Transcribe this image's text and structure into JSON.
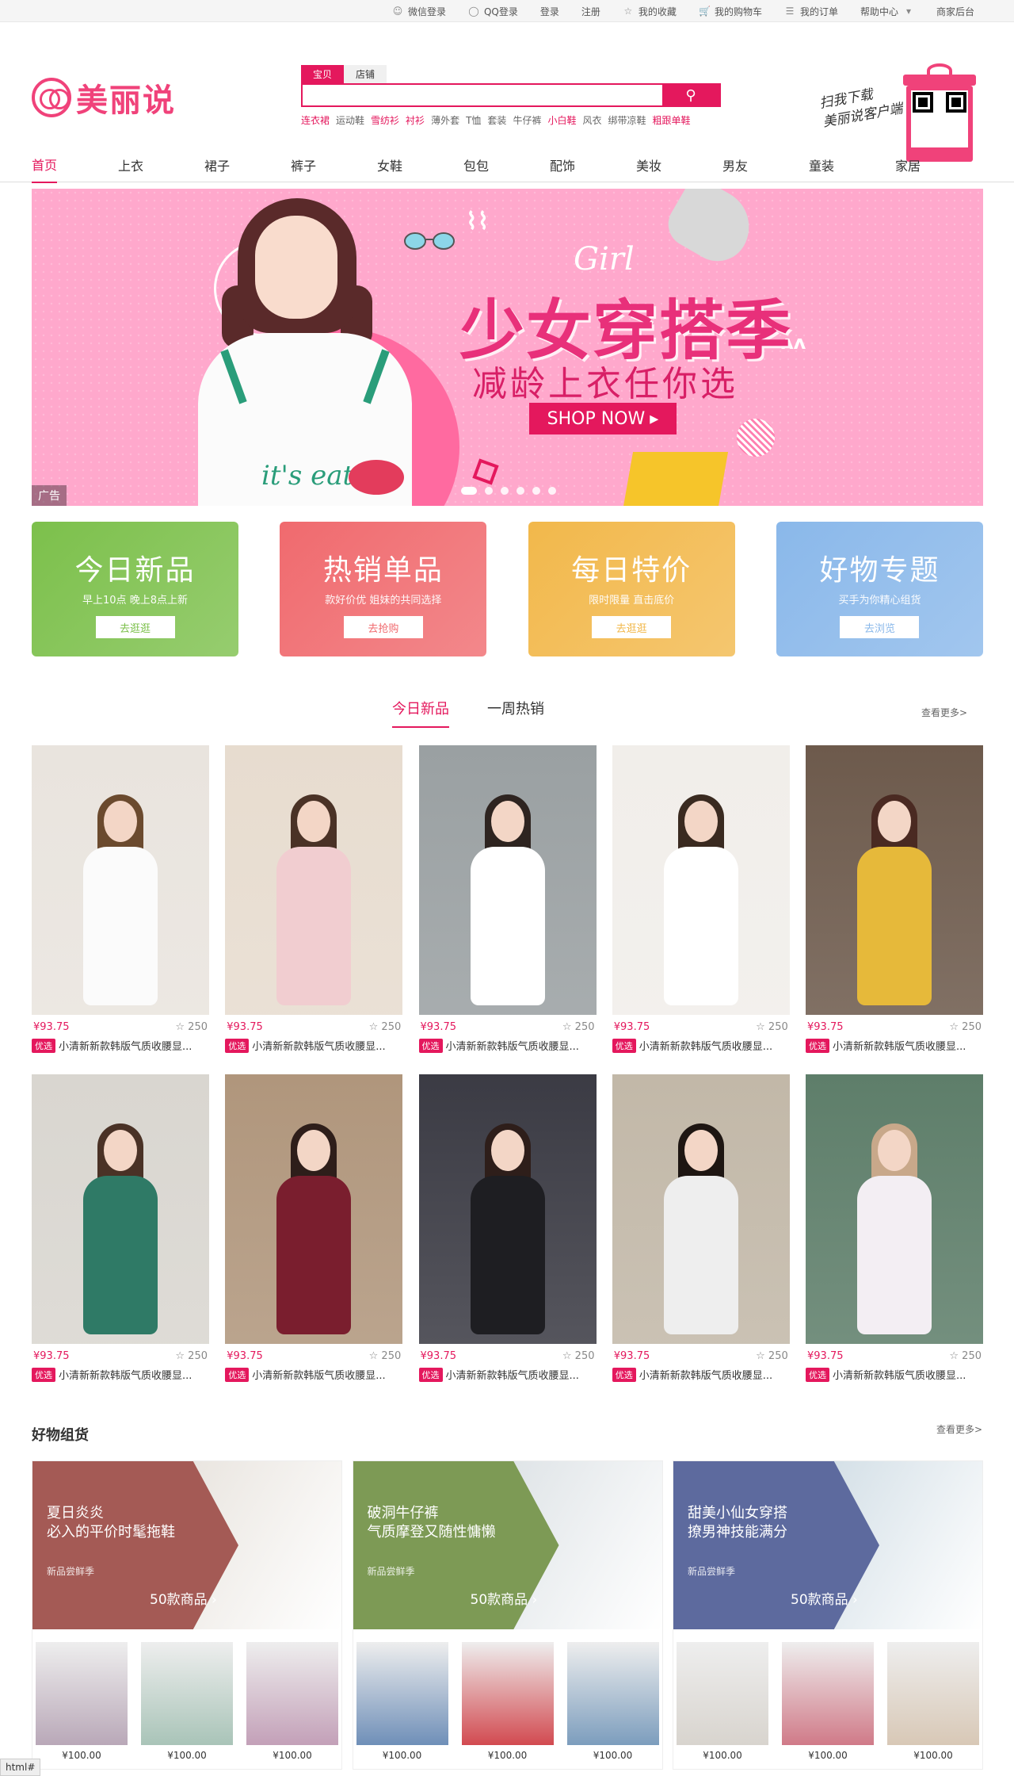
{
  "topbar": {
    "items": [
      "微信登录",
      "QQ登录",
      "登录",
      "注册",
      "我的收藏",
      "我的购物车",
      "我的订单",
      "帮助中心",
      "商家后台"
    ]
  },
  "logo": {
    "text": "美丽说"
  },
  "search": {
    "tabs": [
      "宝贝",
      "店铺"
    ],
    "active_tab": "宝贝",
    "value": "",
    "hot_words": [
      "连衣裙",
      "运动鞋",
      "雪纺衫",
      "衬衫",
      "薄外套",
      "T恤",
      "套装",
      "牛仔裤",
      "小白鞋",
      "风衣",
      "绑带凉鞋",
      "粗跟单鞋"
    ],
    "hot_red": [
      "连衣裙",
      "雪纺衫",
      "衬衫",
      "小白鞋",
      "粗跟单鞋"
    ]
  },
  "download": {
    "line1": "扫我下载",
    "line2": "美丽说客户端"
  },
  "nav": {
    "items": [
      "首页",
      "上衣",
      "裙子",
      "裤子",
      "女鞋",
      "包包",
      "配饰",
      "美妆",
      "男友",
      "童装",
      "家居"
    ],
    "active": "首页"
  },
  "banner": {
    "girl": "Girl",
    "title": "少女穿搭季",
    "subtitle": "减龄上衣任你选",
    "button": "SHOP NOW",
    "model_text": "it's eat",
    "ad_label": "广告",
    "slides": 6,
    "active_slide": 0
  },
  "promos": [
    {
      "title": "今日新品",
      "desc": "早上10点 晚上8点上新",
      "button": "去逛逛",
      "color": "#7cc04b"
    },
    {
      "title": "热销单品",
      "desc": "款好价优 姐妹的共同选择",
      "button": "去抢购",
      "color": "#f06a6e"
    },
    {
      "title": "每日特价",
      "desc": "限时限量 直击底价",
      "button": "去逛逛",
      "color": "#f2b84b"
    },
    {
      "title": "好物专题",
      "desc": "买手为你精心组货",
      "button": "去浏览",
      "color": "#8ab8ea"
    }
  ],
  "section_tabs": {
    "items": [
      "今日新品",
      "一周热销"
    ],
    "active": "今日新品",
    "more": "查看更多>"
  },
  "products": {
    "price": "¥93.75",
    "favorites": "250",
    "tag": "优选",
    "name": "小清新新款韩版气质收腰显...",
    "rows": [
      [
        {
          "bg": "#e9e4de",
          "dress": "#fbfbfb",
          "hair": "#6b4a2e"
        },
        {
          "bg": "#e7dccf",
          "dress": "#f1cdd0",
          "hair": "#4a3226"
        },
        {
          "bg": "#9aa0a2",
          "dress": "#ffffff",
          "hair": "#2e2420"
        },
        {
          "bg": "#f1eeea",
          "dress": "#ffffff",
          "hair": "#3a2a20"
        },
        {
          "bg": "#6d5a4c",
          "dress": "#e6b93a",
          "hair": "#4a2a22"
        }
      ],
      [
        {
          "bg": "#d9d6d0",
          "dress": "#2f7a66",
          "hair": "#4a3226"
        },
        {
          "bg": "#b0967c",
          "dress": "#7a1e2e",
          "hair": "#2e1e1a"
        },
        {
          "bg": "#3b3b44",
          "dress": "#1e1e22",
          "hair": "#2e1e1a"
        },
        {
          "bg": "#c2b8a8",
          "dress": "#eeeeee",
          "hair": "#1e1612"
        },
        {
          "bg": "#5e7e6a",
          "dress": "#f3eef3",
          "hair": "#c8a88a"
        }
      ]
    ]
  },
  "bundles_section": {
    "title": "好物组货",
    "more": "查看更多>"
  },
  "bundles": [
    {
      "line1": "夏日炎炎",
      "line2": "必入的平价时髦拖鞋",
      "label": "新品尝鲜季",
      "count": "50款商品",
      "color": "#a45a55",
      "photo": "#dcd5cc",
      "items": [
        {
          "price": "¥100.00",
          "c": "#b9a8b8"
        },
        {
          "price": "¥100.00",
          "c": "#a9c4b8"
        },
        {
          "price": "¥100.00",
          "c": "#c3a0b8"
        }
      ]
    },
    {
      "line1": "破洞牛仔裤",
      "line2": "气质摩登又随性慵懒",
      "label": "新品尝鲜季",
      "count": "50款商品",
      "color": "#7d9a55",
      "photo": "#cbd3d8",
      "items": [
        {
          "price": "¥100.00",
          "c": "#6f8fb8"
        },
        {
          "price": "¥100.00",
          "c": "#d24a50"
        },
        {
          "price": "¥100.00",
          "c": "#7c9dbd"
        }
      ]
    },
    {
      "line1": "甜美小仙女穿搭",
      "line2": "撩男神技能满分",
      "label": "新品尝鲜季",
      "count": "50款商品",
      "color": "#5d6a9e",
      "photo": "#b9ccd8",
      "items": [
        {
          "price": "¥100.00",
          "c": "#d8d4ce"
        },
        {
          "price": "¥100.00",
          "c": "#d07a88"
        },
        {
          "price": "¥100.00",
          "c": "#d8c8b6"
        }
      ]
    }
  ],
  "status": {
    "text": "html#"
  }
}
